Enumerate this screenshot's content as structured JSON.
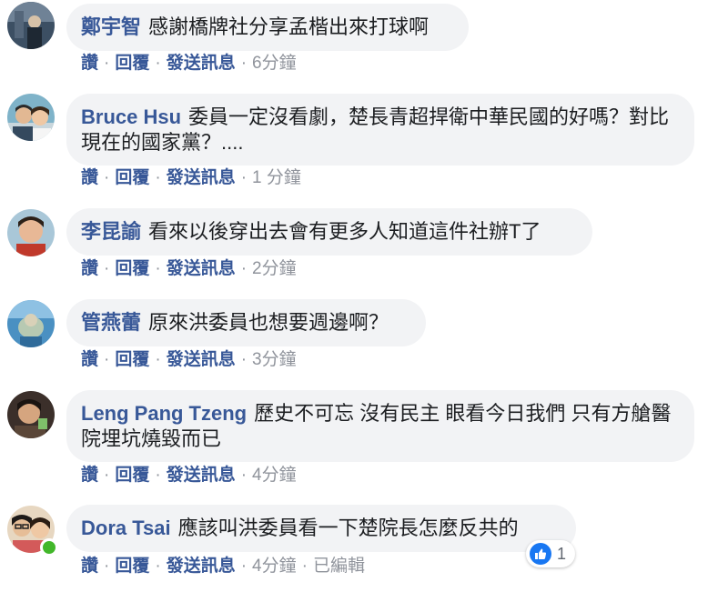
{
  "comments": [
    {
      "author": "鄭宇智",
      "text": "感謝橋牌社分享孟楷出來打球啊",
      "like": "讚",
      "reply": "回覆",
      "message": "發送訊息",
      "time": "6分鐘"
    },
    {
      "author": "Bruce Hsu",
      "text": "委員一定沒看劇，楚長青超捍衛中華民國的好嗎？對比現在的國家黨？....",
      "like": "讚",
      "reply": "回覆",
      "message": "發送訊息",
      "time": "1 分鐘"
    },
    {
      "author": "李昆諭",
      "text": "看來以後穿出去會有更多人知道這件社辦T了",
      "like": "讚",
      "reply": "回覆",
      "message": "發送訊息",
      "time": "2分鐘"
    },
    {
      "author": "管燕蕾",
      "text": "原來洪委員也想要週邊啊？",
      "like": "讚",
      "reply": "回覆",
      "message": "發送訊息",
      "time": "3分鐘"
    },
    {
      "author": "Leng Pang Tzeng",
      "text": "歷史不可忘 沒有民主 眼看今日我們 只有方艙醫院埋坑燒毀而已",
      "like": "讚",
      "reply": "回覆",
      "message": "發送訊息",
      "time": "4分鐘"
    },
    {
      "author": "Dora Tsai",
      "text": "應該叫洪委員看一下楚院長怎麼反共的",
      "like": "讚",
      "reply": "回覆",
      "message": "發送訊息",
      "time": "4分鐘",
      "edited": "已編輯",
      "reaction_count": "1",
      "online": true
    }
  ],
  "colors": {
    "author": "#385898",
    "bubble": "#f2f3f5",
    "meta": "#90949c",
    "like": "#1877f2",
    "online": "#42b72a"
  }
}
